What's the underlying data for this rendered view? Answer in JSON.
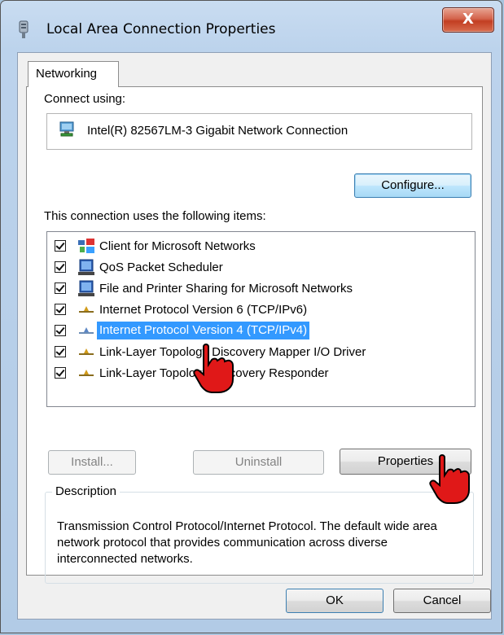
{
  "window": {
    "title": "Local Area Connection Properties",
    "close_label": "X"
  },
  "tabs": [
    {
      "label": "Networking",
      "selected": true
    }
  ],
  "connect_using": {
    "label": "Connect using:",
    "adapter": "Intel(R) 82567LM-3 Gigabit Network Connection",
    "configure_label": "Configure..."
  },
  "items": {
    "label": "This connection uses the following items:",
    "list": [
      {
        "label": "Client for Microsoft Networks",
        "checked": true,
        "icon": "network-client-icon"
      },
      {
        "label": "QoS Packet Scheduler",
        "checked": true,
        "icon": "computer-service-icon"
      },
      {
        "label": "File and Printer Sharing for Microsoft Networks",
        "checked": true,
        "icon": "computer-service-icon"
      },
      {
        "label": "Internet Protocol Version 6 (TCP/IPv6)",
        "checked": true,
        "icon": "protocol-icon"
      },
      {
        "label": "Internet Protocol Version 4 (TCP/IPv4)",
        "checked": true,
        "icon": "protocol-icon",
        "selected": true
      },
      {
        "label": "Link-Layer Topology Discovery Mapper I/O Driver",
        "checked": true,
        "icon": "protocol-icon"
      },
      {
        "label": "Link-Layer Topology Discovery Responder",
        "checked": true,
        "icon": "protocol-icon"
      }
    ]
  },
  "buttons": {
    "install": "Install...",
    "uninstall": "Uninstall",
    "properties": "Properties",
    "ok": "OK",
    "cancel": "Cancel"
  },
  "description": {
    "legend": "Description",
    "text": "Transmission Control Protocol/Internet Protocol. The default wide area network protocol that provides communication across diverse interconnected networks."
  },
  "colors": {
    "selection": "#3399ff",
    "close_button": "#c94a2e",
    "focus_button": "#bee6fd"
  }
}
